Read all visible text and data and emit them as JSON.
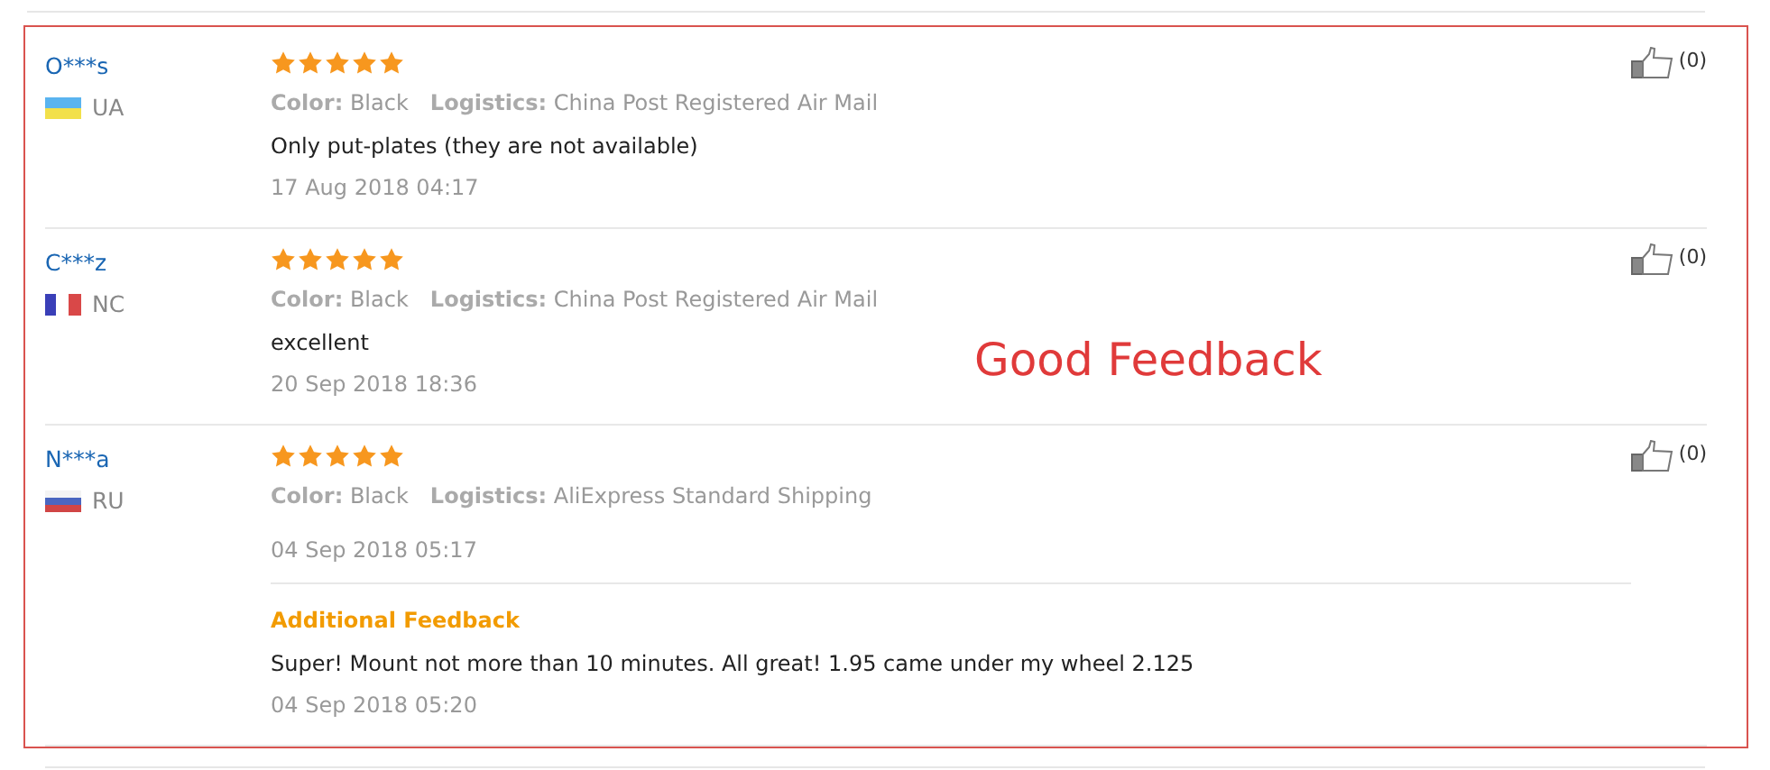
{
  "reviews": [
    {
      "user": "O***s",
      "kind": "ua",
      "country": "UA",
      "stars": 5,
      "color_label": "Color:",
      "color_value": "Black",
      "logistics_label": "Logistics:",
      "logistics_value": "China Post Registered Air Mail",
      "text": "Only put-plates (they are not available)",
      "date": "17 Aug 2018 04:17",
      "likes": "(0)"
    },
    {
      "user": "C***z",
      "kind": "fr",
      "country": "NC",
      "stars": 5,
      "color_label": "Color:",
      "color_value": "Black",
      "logistics_label": "Logistics:",
      "logistics_value": "China Post Registered Air Mail",
      "text": "excellent",
      "date": "20 Sep 2018 18:36",
      "likes": "(0)"
    },
    {
      "user": "N***a",
      "kind": "ru",
      "country": "RU",
      "stars": 5,
      "color_label": "Color:",
      "color_value": "Black",
      "logistics_label": "Logistics:",
      "logistics_value": "AliExpress Standard Shipping",
      "date": "04 Sep 2018 05:17",
      "likes": "(0)",
      "additional": {
        "title": "Additional Feedback",
        "text": "Super! Mount not more than 10 minutes. All great! 1.95 came under my wheel 2.125",
        "date": "04 Sep 2018 05:20"
      }
    }
  ],
  "annotation": "Good Feedback"
}
